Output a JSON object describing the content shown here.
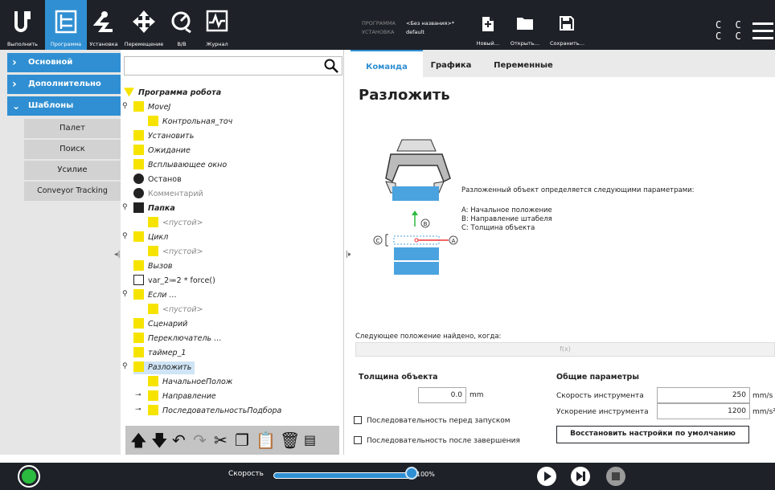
{
  "topbar": {
    "tabs": [
      {
        "label": "Выполнить",
        "icon": "ur-logo-icon"
      },
      {
        "label": "Программа",
        "icon": "program-tree-icon",
        "active": true
      },
      {
        "label": "Установка",
        "icon": "installation-icon"
      },
      {
        "label": "Перемещение",
        "icon": "move-arrows-icon"
      },
      {
        "label": "В/В",
        "icon": "io-icon"
      },
      {
        "label": "Журнал",
        "icon": "log-icon"
      }
    ],
    "program_key": "ПРОГРАММА",
    "program_value": "<Без названия>*",
    "install_key": "УСТАНОВКА",
    "install_value": "default",
    "file_buttons": [
      "Новый…",
      "Открыть…",
      "Сохранить…"
    ],
    "status": "C C\nC C"
  },
  "sidebar": {
    "categories": [
      "Основной",
      "Дополнительно",
      "Шаблоны"
    ],
    "template_items": [
      "Палет",
      "Поиск",
      "Усилие",
      "Conveyor Tracking"
    ]
  },
  "tree": {
    "search_placeholder": "",
    "nodes": [
      {
        "text": "Программа робота"
      },
      {
        "text": "MoveJ"
      },
      {
        "text": "Контрольная_точ"
      },
      {
        "text": "Установить"
      },
      {
        "text": "Ожидание"
      },
      {
        "text": "Всплывающее окно"
      },
      {
        "text": "Останов"
      },
      {
        "text": "Комментарий"
      },
      {
        "text": "Папка"
      },
      {
        "text": "<пустой>"
      },
      {
        "text": "Цикл"
      },
      {
        "text": "<пустой>"
      },
      {
        "text": "Вызов"
      },
      {
        "text": "var_2≔2 * force()"
      },
      {
        "text": "Если …"
      },
      {
        "text": "<пустой>"
      },
      {
        "text": "Сценарий"
      },
      {
        "text": "Переключатель …"
      },
      {
        "text": "таймер_1"
      },
      {
        "text": "Разложить"
      },
      {
        "text": "НачальноеПолож"
      },
      {
        "text": "Направление"
      },
      {
        "text": "ПоследовательностьПодбора"
      }
    ]
  },
  "panel": {
    "tabs": [
      "Команда",
      "Графика",
      "Переменные"
    ],
    "active_tab": "Команда",
    "title": "Разложить",
    "description": "Разложенный объект определяется следующими параметрами:",
    "param_a": "A: Начальное положение",
    "param_b": "B: Направление штабеля",
    "param_c": "C: Толщина объекта",
    "diagram_labels": {
      "a": "A",
      "b": "B",
      "c": "C"
    },
    "condition_label": "Следующее положение найдено, когда:",
    "condition_value": "f(x)",
    "thickness_heading": "Толщина объекта",
    "thickness_value": "0.0",
    "thickness_unit": "mm",
    "general_heading": "Общие параметры",
    "tool_speed_label": "Скорость инструмента",
    "tool_speed_value": "250",
    "tool_speed_unit": "mm/s",
    "tool_accel_label": "Ускорение инструмента",
    "tool_accel_value": "1200",
    "tool_accel_unit": "mm/s²",
    "seq_before": "Последовательность перед запуском",
    "seq_after": "Последовательность после завершения",
    "reset_button": "Восстановить настройки по умолчанию"
  },
  "footer": {
    "speed_label": "Скорость",
    "speed_value": "100%",
    "speed_fraction": 1.0
  },
  "colors": {
    "accent": "#2f8fd2",
    "dark": "#1e2228",
    "node_yellow": "#f6e400",
    "power_green": "#2bbb3f"
  }
}
